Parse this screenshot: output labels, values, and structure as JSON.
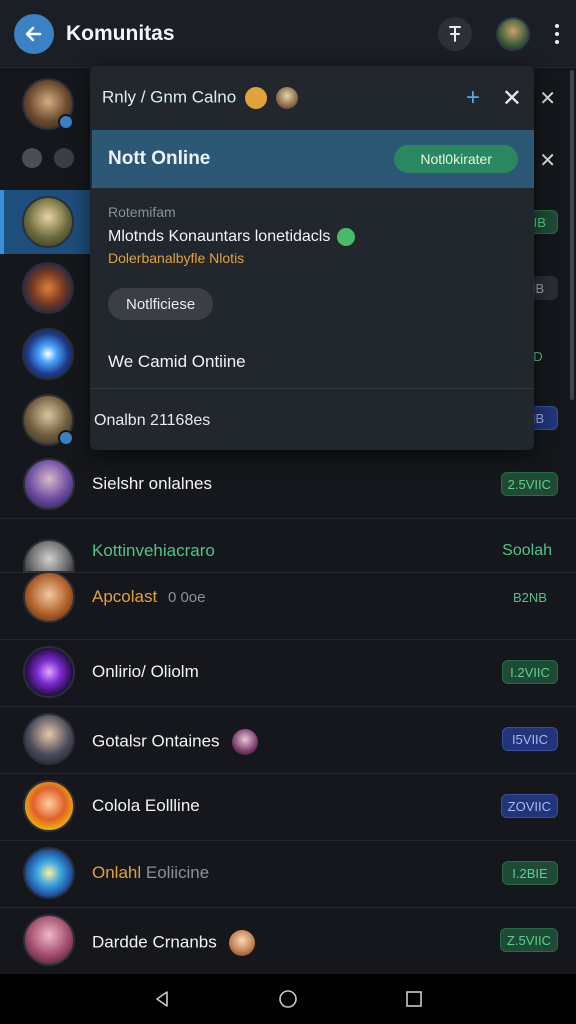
{
  "header": {
    "title": "Komunitas",
    "icons": [
      "back-arrow-icon",
      "pin-icon",
      "avatar",
      "more-vertical-icon"
    ]
  },
  "panel": {
    "header_title": "Rnly / Gnm Calno",
    "banner_title": "Nott Online",
    "banner_button": "Notl0kirater",
    "sub_label": "Rotemifam",
    "main_line": "Mlotnds Konauntars lonetidacls",
    "orange_line": "Dolerbanalbyfle Nlotis",
    "pill_button": "Notlficiese",
    "status_line": "We Camid Ontiine",
    "footer_line": "Onalbn 21168es"
  },
  "peek": {
    "tag1": "IIB",
    "tag2": "IB",
    "tag3": "D",
    "tag4": "IB"
  },
  "chats": [
    {
      "name": "Sielshr onlalnes",
      "tag": "2.5VIIC",
      "tag_style": "green",
      "name_color": "#f2f3f5",
      "av": "a1"
    },
    {
      "name": "Kottinvehiacraro",
      "tag": "Soolah",
      "tag_style": "plain",
      "name_color": "#4fc489",
      "av": "a2"
    },
    {
      "name": "Apcolast",
      "name_suffix": "0 0oe",
      "tag": "B2NB",
      "tag_style": "plain",
      "name_color": "#e2a23b",
      "av": "a3"
    },
    {
      "name": "Onlirio/ Oliolm",
      "tag": "I.2VIIC",
      "tag_style": "green",
      "name_color": "#f2f3f5",
      "av": "a4"
    },
    {
      "name": "Gotalsr Ontaines",
      "tag": "I5VIIC",
      "tag_style": "blue",
      "name_color": "#f2f3f5",
      "av": "a5"
    },
    {
      "name": "Colola Eollline",
      "tag": "ZOVIIC",
      "tag_style": "blue",
      "name_color": "#f2f3f5",
      "av": "a6"
    },
    {
      "name": "Onlahl",
      "name_suffix": "Eoliicine",
      "tag": "I.2BIE",
      "tag_style": "green",
      "name_color": "#e2a23b",
      "av": "a7"
    },
    {
      "name": "Dardde Crnanbs",
      "tag": "Z.5VIIC",
      "tag_style": "green",
      "name_color": "#f2f3f5",
      "av": "a8"
    }
  ],
  "colors": {
    "accent_blue": "#3b82c4",
    "accent_green": "#2b8762",
    "accent_orange": "#e2a23b",
    "background": "#15171c"
  }
}
